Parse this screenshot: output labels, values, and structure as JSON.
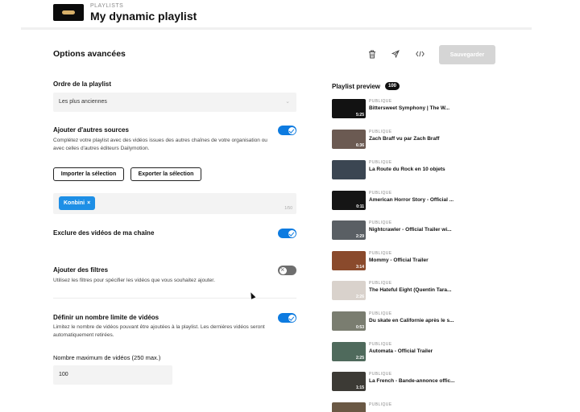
{
  "header": {
    "kicker": "PLAYLISTS",
    "title": "My dynamic playlist"
  },
  "options": {
    "section_title": "Options avancées",
    "order_label": "Ordre de la playlist",
    "order_value": "Les plus anciennes",
    "sources_label": "Ajouter d'autres sources",
    "sources_desc_1": "Complétez votre playlist avec des vidéos issues des autres chaînes de votre organisation ou",
    "sources_desc_2": "avec celles d'autres éditeurs Dailymotion.",
    "import_button": "Importer la sélection",
    "export_button": "Exporter la sélection",
    "tag": "Konbini",
    "tag_remove": "×",
    "tag_counter": "1/50",
    "exclude_label": "Exclure des vidéos de ma chaîne",
    "filters_label": "Ajouter des filtres",
    "filters_desc": "Utilisez les filtres pour spécifier les vidéos que vous souhaitez ajouter.",
    "limit_label": "Définir un nombre limite de vidéos",
    "limit_desc_1": "Limitez le nombre de vidéos pouvant être ajoutées à la playlist. Les dernières vidéos seront",
    "limit_desc_2": "automatiquement retirées.",
    "max_label": "Nombre maximum de vidéos (250 max.)",
    "max_value": "100"
  },
  "toggles": {
    "sources": true,
    "exclude": true,
    "filters": false,
    "limit": true
  },
  "toolbar": {
    "save_label": "Sauvegarder",
    "delete_icon": "trash-icon",
    "share_icon": "send-icon",
    "embed_icon": "code-icon"
  },
  "preview": {
    "title": "Playlist preview",
    "count": "100",
    "items": [
      {
        "visibility": "PUBLIQUE",
        "title": "Bittersweet Symphony | The W...",
        "duration": "5:25",
        "color": "#121212"
      },
      {
        "visibility": "PUBLIQUE",
        "title": "Zach Braff vu par Zach Braff",
        "duration": "6:36",
        "color": "#6b5a52"
      },
      {
        "visibility": "PUBLIQUE",
        "title": "La Route du Rock en 10 objets",
        "duration": "",
        "color": "#3b4652"
      },
      {
        "visibility": "PUBLIQUE",
        "title": "American Horror Story - Official ...",
        "duration": "0:11",
        "color": "#151515"
      },
      {
        "visibility": "PUBLIQUE",
        "title": "Nightcrawler - Official Trailer wi...",
        "duration": "2:29",
        "color": "#5a5f64"
      },
      {
        "visibility": "PUBLIQUE",
        "title": "Mommy - Official Trailer",
        "duration": "3:14",
        "color": "#8a4a2c"
      },
      {
        "visibility": "PUBLIQUE",
        "title": "The Hateful Eight (Quentin Tara...",
        "duration": "2:26",
        "color": "#d9d2cc"
      },
      {
        "visibility": "PUBLIQUE",
        "title": "Du skate en Californie après le s...",
        "duration": "0:53",
        "color": "#7a7d70"
      },
      {
        "visibility": "PUBLIQUE",
        "title": "Automata - Official Trailer",
        "duration": "2:25",
        "color": "#4f6a5c"
      },
      {
        "visibility": "PUBLIQUE",
        "title": "La French - Bande-annonce offic...",
        "duration": "1:15",
        "color": "#3c3a35"
      },
      {
        "visibility": "PUBLIQUE",
        "title": "",
        "duration": "",
        "color": "#6a5844"
      }
    ]
  },
  "colors": {
    "accent": "#0d7be0",
    "tag": "#1e8fe6",
    "save_disabled": "#d5d5d5"
  }
}
